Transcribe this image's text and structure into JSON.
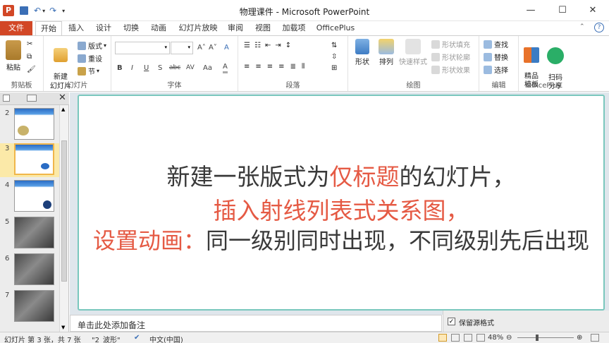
{
  "window": {
    "title": "物理课件 - Microsoft PowerPoint",
    "controls": {
      "minimize": "—",
      "maximize": "☐",
      "close": "✕"
    },
    "help": "?"
  },
  "tabs": [
    "文件",
    "开始",
    "插入",
    "设计",
    "切换",
    "动画",
    "幻灯片放映",
    "审阅",
    "视图",
    "加载项",
    "OfficePlus"
  ],
  "active_tab": "开始",
  "ribbon": {
    "clipboard": {
      "label": "剪贴板",
      "paste": "粘贴"
    },
    "slides": {
      "label": "幻灯片",
      "new_slide": "新建\n幻灯片",
      "layout": "版式",
      "reset": "重设",
      "section": "节"
    },
    "font": {
      "label": "字体",
      "bold": "B",
      "italic": "I",
      "underline": "U",
      "shadow": "S",
      "strike": "abc",
      "spacing": "AV",
      "case": "Aa",
      "color": "A",
      "grow": "A˄",
      "shrink": "A˅",
      "clear": "A"
    },
    "paragraph": {
      "label": "段落"
    },
    "drawing": {
      "label": "绘图",
      "shapes": "形状",
      "arrange": "排列",
      "quick_styles": "快速样式",
      "shape_fill": "形状填充",
      "shape_outline": "形状轮廓",
      "shape_effects": "形状效果"
    },
    "editing": {
      "label": "编辑",
      "find": "查找",
      "replace": "替换",
      "select": "选择"
    },
    "officeplus": {
      "label": "OfficePlus",
      "templates": "精品\n模板",
      "share": "扫码\n分享"
    }
  },
  "thumbnails": [
    {
      "num": "2",
      "style": "blue",
      "selected": false
    },
    {
      "num": "3",
      "style": "blue",
      "selected": true
    },
    {
      "num": "4",
      "style": "blue",
      "selected": false
    },
    {
      "num": "5",
      "style": "dark",
      "selected": false
    },
    {
      "num": "6",
      "style": "dark",
      "selected": false
    },
    {
      "num": "7",
      "style": "dark",
      "selected": false
    }
  ],
  "slide": {
    "line1_a": "新建一张版式为",
    "line1_b": "仅标题",
    "line1_c": "的幻灯片，",
    "line2": "插入射线列表式关系图，",
    "line3_a": "设置动画：",
    "line3_b": "同一级别同时出现，不同级别先后出现"
  },
  "notes_placeholder": "单击此处添加备注",
  "right_pane": {
    "keep_format": "保留源格式"
  },
  "status": {
    "slide_info": "幻灯片 第 3 张，共 7 张",
    "theme": "\"2_波形\"",
    "language": "中文(中国)",
    "zoom": "48%"
  },
  "colors": {
    "accent_file": "#d24726",
    "emphasis_red": "#e55a44",
    "selection": "#f0b64a",
    "slide_border": "#79c7bd"
  }
}
